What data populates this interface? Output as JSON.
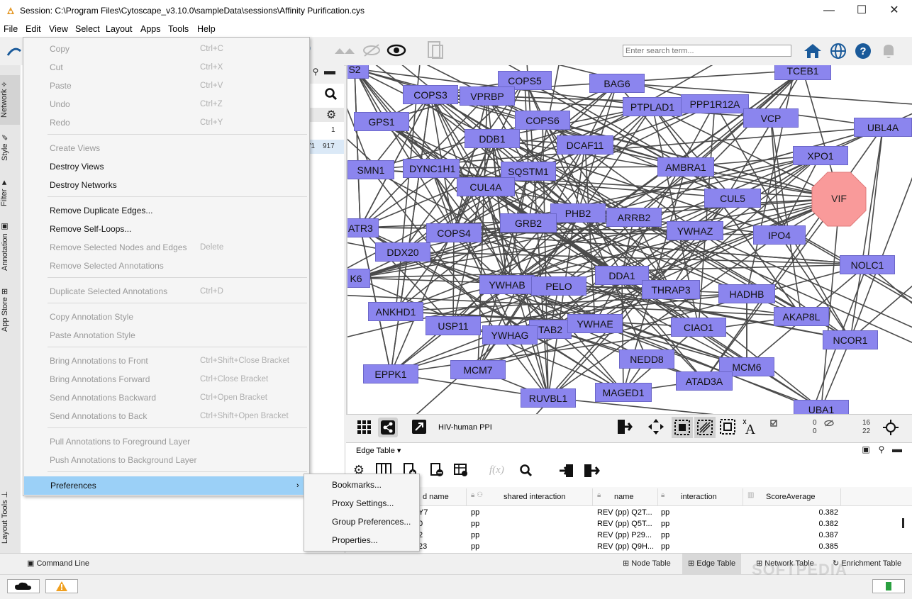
{
  "window": {
    "title": "Session: C:\\Program Files\\Cytoscape_v3.10.0\\sampleData\\sessions\\Affinity Purification.cys",
    "minimize": "—",
    "maximize": "☐",
    "close": "✕"
  },
  "menubar": [
    "File",
    "Edit",
    "View",
    "Select",
    "Layout",
    "Apps",
    "Tools",
    "Help"
  ],
  "toolbar": {
    "search_placeholder": "Enter search term..."
  },
  "left_tabs": [
    "Network",
    "Style",
    "Filter",
    "Annotation",
    "App Store",
    "Layout Tools"
  ],
  "control_panel": {
    "row1_value": "1",
    "row2_a": "71",
    "row2_b": "917"
  },
  "edit_menu": {
    "items": [
      {
        "label": "Copy",
        "shortcut": "Ctrl+C",
        "enabled": false
      },
      {
        "label": "Cut",
        "shortcut": "Ctrl+X",
        "enabled": false
      },
      {
        "label": "Paste",
        "shortcut": "Ctrl+V",
        "enabled": false
      },
      {
        "label": "Undo",
        "shortcut": "Ctrl+Z",
        "enabled": false
      },
      {
        "label": "Redo",
        "shortcut": "Ctrl+Y",
        "enabled": false
      },
      {
        "label": "Create Views",
        "shortcut": "",
        "enabled": false
      },
      {
        "label": "Destroy Views",
        "shortcut": "",
        "enabled": true
      },
      {
        "label": "Destroy Networks",
        "shortcut": "",
        "enabled": true
      },
      {
        "label": "Remove Duplicate Edges...",
        "shortcut": "",
        "enabled": true
      },
      {
        "label": "Remove Self-Loops...",
        "shortcut": "",
        "enabled": true
      },
      {
        "label": "Remove Selected Nodes and Edges",
        "shortcut": "Delete",
        "enabled": false
      },
      {
        "label": "Remove Selected Annotations",
        "shortcut": "",
        "enabled": false
      },
      {
        "label": "Duplicate Selected Annotations",
        "shortcut": "Ctrl+D",
        "enabled": false
      },
      {
        "label": "Copy Annotation Style",
        "shortcut": "",
        "enabled": false
      },
      {
        "label": "Paste Annotation Style",
        "shortcut": "",
        "enabled": false
      },
      {
        "label": "Bring Annotations to Front",
        "shortcut": "Ctrl+Shift+Close Bracket",
        "enabled": false
      },
      {
        "label": "Bring Annotations Forward",
        "shortcut": "Ctrl+Close Bracket",
        "enabled": false
      },
      {
        "label": "Send Annotations Backward",
        "shortcut": "Ctrl+Open Bracket",
        "enabled": false
      },
      {
        "label": "Send Annotations to Back",
        "shortcut": "Ctrl+Shift+Open Bracket",
        "enabled": false
      },
      {
        "label": "Pull Annotations to Foreground Layer",
        "shortcut": "",
        "enabled": false
      },
      {
        "label": "Push Annotations to Background Layer",
        "shortcut": "",
        "enabled": false
      },
      {
        "label": "Preferences",
        "shortcut": "",
        "enabled": true
      }
    ]
  },
  "preferences_submenu": [
    "Bookmarks...",
    "Proxy Settings...",
    "Group Preferences...",
    "Properties..."
  ],
  "network": {
    "nodes": [
      "S2",
      "COPS5",
      "BAG6",
      "TCEB1",
      "COPS3",
      "VPRBP",
      "PTPLAD1",
      "PPP1R12A",
      "GPS1",
      "COPS6",
      "VCP",
      "UBL4A",
      "DDB1",
      "DCAF11",
      "XPO1",
      "SMN1",
      "DYNC1H1",
      "SQSTM1",
      "AMBRA1",
      "VIF",
      "CUL4A",
      "CUL5",
      "PHB2",
      "ARRB2",
      "ATR3",
      "GRB2",
      "COPS4",
      "YWHAZ",
      "IPO4",
      "DDX20",
      "NOLC1",
      "K6",
      "DDA1",
      "YWHAB",
      "PELO",
      "THRAP3",
      "HADHB",
      "ANKHD1",
      "AKAP8L",
      "USP11",
      "TAB2",
      "YWHAE",
      "CIAO1",
      "YWHAG",
      "NCOR1",
      "NEDD8",
      "EPPK1",
      "MCM7",
      "MCM6",
      "ATAD3A",
      "RUVBL1",
      "MAGED1",
      "UBA1"
    ],
    "node_color": "#8b85ee",
    "target_node_color": "#f99a9a",
    "network_name": "HIV-human PPI",
    "counts": {
      "sel_nodes": "0",
      "sel_edges": "0",
      "hidden_nodes": "16",
      "hidden_edges": "22"
    }
  },
  "edge_table": {
    "selector": "Edge Table",
    "columns": [
      "d name",
      "shared interaction",
      "name",
      "interaction",
      "ScoreAverage"
    ],
    "rows": [
      {
        "a": "Y7",
        "b": "pp",
        "c": "REV (pp) Q2T...",
        "d": "pp",
        "e": "0.382"
      },
      {
        "a": "0",
        "b": "pp",
        "c": "REV (pp) Q5T...",
        "d": "pp",
        "e": "0.382"
      },
      {
        "a": "2",
        "b": "pp",
        "c": "REV (pp) P29...",
        "d": "pp",
        "e": "0.387"
      },
      {
        "a": "23",
        "b": "pp",
        "c": "REV (pp) Q9H...",
        "d": "pp",
        "e": "0.385"
      }
    ]
  },
  "bottom_tabs": {
    "command_line": "Command Line",
    "node_table": "Node Table",
    "edge_table": "Edge Table",
    "network_table": "Network Table",
    "enrichment_table": "Enrichment Table"
  },
  "watermark": "SOFTPEDIA"
}
